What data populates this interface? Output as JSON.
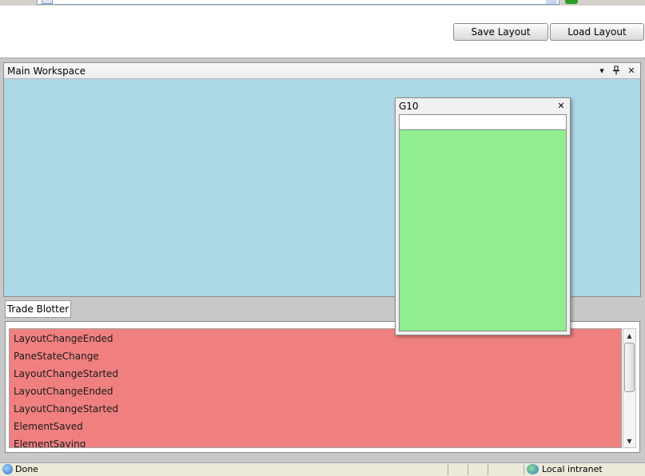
{
  "toolbar": {
    "save_label": "Save Layout",
    "load_label": "Load Layout"
  },
  "main_pane": {
    "title": "Main Workspace",
    "background_color": "#add8e6",
    "icons": [
      "dropdown-menu-icon",
      "pin-icon",
      "close-icon"
    ]
  },
  "floating_window": {
    "title": "G10",
    "input_value": "",
    "content_color": "#90ee90"
  },
  "tabs": [
    {
      "label": "Trade Blotter"
    }
  ],
  "blotter": {
    "list_color": "#f08080",
    "events": [
      "LayoutChangeEnded",
      "PaneStateChange",
      "LayoutChangeStarted",
      "LayoutChangeEnded",
      "LayoutChangeStarted",
      "ElementSaved",
      "ElementSaving"
    ]
  },
  "status_bar": {
    "status_text": "Done",
    "zone_text": "Local intranet"
  },
  "glyphs": {
    "menu": "▾",
    "pin": "⊥",
    "close": "✕",
    "scroll_up": "▲",
    "scroll_down": "▼"
  }
}
